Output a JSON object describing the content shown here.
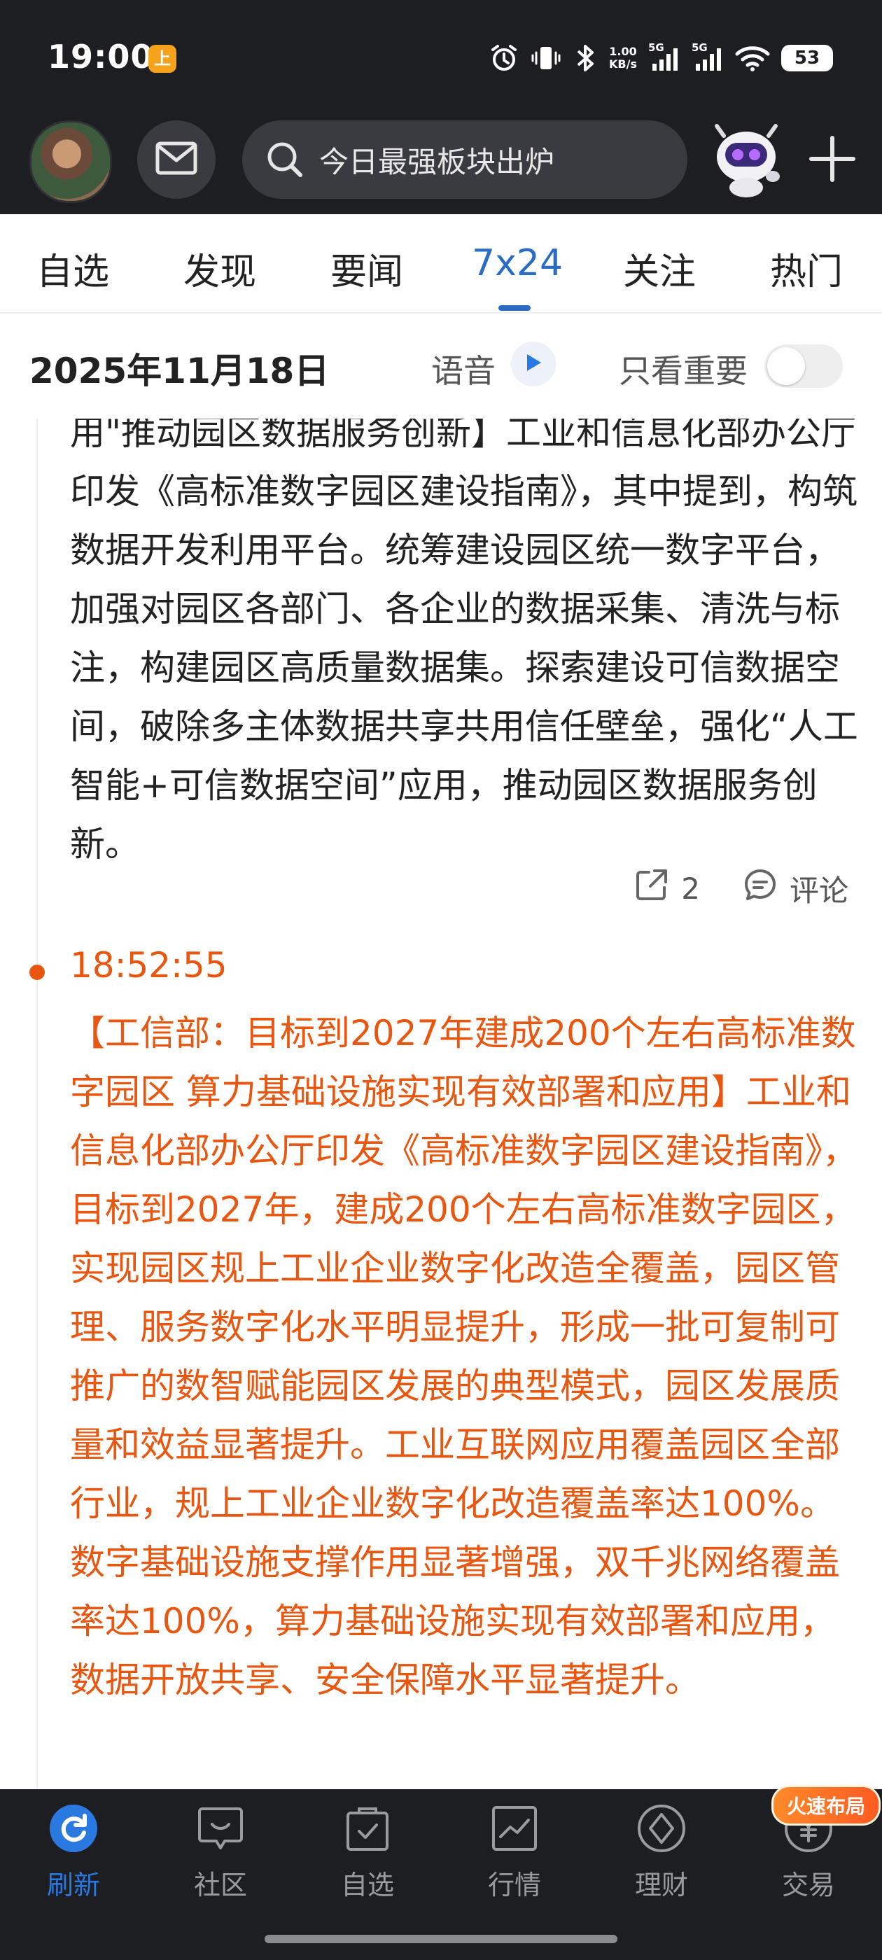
{
  "status_bar": {
    "time": "19:00",
    "app_icon_text": "上",
    "net_speed_value": "1.00",
    "net_speed_unit": "KB/s",
    "signal1_label": "5G",
    "signal2_label": "5G",
    "battery": "53"
  },
  "header": {
    "search_placeholder": "今日最强板块出炉"
  },
  "tabs": [
    {
      "label": "自选"
    },
    {
      "label": "发现"
    },
    {
      "label": "要闻"
    },
    {
      "label": "7x24"
    },
    {
      "label": "关注"
    },
    {
      "label": "热门"
    }
  ],
  "date_bar": {
    "date": "2025年11月18日",
    "voice_label": "语音",
    "only_important_label": "只看重要",
    "only_important_on": false
  },
  "feed": {
    "item1": {
      "text": "用\"推动园区数据服务创新】工业和信息化部办公厅印发《高标准数字园区建设指南》，其中提到，构筑数据开发利用平台。统筹建设园区统一数字平台，加强对园区各部门、各企业的数据采集、清洗与标注，构建园区高质量数据集。探索建设可信数据空间，破除多主体数据共享共用信任壁垒，强化“人工智能+可信数据空间”应用，推动园区数据服务创新。",
      "share_count": "2",
      "comment_label": "评论"
    },
    "item2": {
      "time": "18:52:55",
      "text": "【工信部：目标到2027年建成200个左右高标准数字园区 算力基础设施实现有效部署和应用】工业和信息化部办公厅印发《高标准数字园区建设指南》，目标到2027年，建成200个左右高标准数字园区，实现园区规上工业企业数字化改造全覆盖，园区管理、服务数字化水平明显提升，形成一批可复制可推广的数智赋能园区发展的典型模式，园区发展质量和效益显著提升。工业互联网应用覆盖园区全部行业，规上工业企业数字化改造覆盖率达100%。数字基础设施支撑作用显著增强，双千兆网络覆盖率达100%，算力基础设施实现有效部署和应用，数据开放共享、安全保障水平显著提升。",
      "accent_color": "#e8560f"
    }
  },
  "bottom_nav": [
    {
      "label": "刷新",
      "icon": "refresh-icon"
    },
    {
      "label": "社区",
      "icon": "chat-icon"
    },
    {
      "label": "自选",
      "icon": "bag-check-icon"
    },
    {
      "label": "行情",
      "icon": "chart-icon"
    },
    {
      "label": "理财",
      "icon": "diamond-icon"
    },
    {
      "label": "交易",
      "icon": "yuan-icon"
    }
  ],
  "badge": "火速布局",
  "colors": {
    "accent_blue": "#2a6cc4",
    "header_bg": "#1d1e22",
    "news_orange": "#e8560f"
  }
}
